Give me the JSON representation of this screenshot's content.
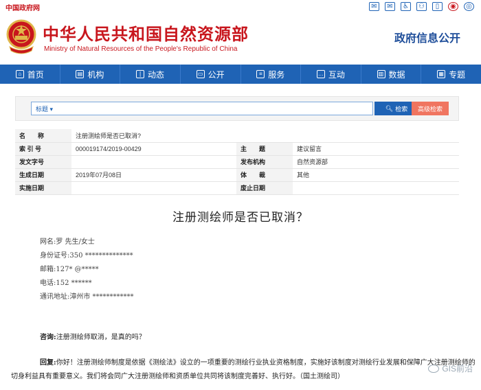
{
  "topbar": {
    "gov_link": "中国政府网",
    "icons": [
      "mail-icon",
      "message-icon",
      "accessibility-icon",
      "user-icon",
      "mobile-icon",
      "weibo-icon",
      "wechat-icon"
    ]
  },
  "header": {
    "title": "中华人民共和国自然资源部",
    "subtitle": "Ministry of Natural Resources of the People's Republic of China",
    "gov_info": "政府信息公开"
  },
  "nav": {
    "items": [
      {
        "label": "首页",
        "icon": "home-icon"
      },
      {
        "label": "机构",
        "icon": "org-icon"
      },
      {
        "label": "动态",
        "icon": "book-icon"
      },
      {
        "label": "公开",
        "icon": "monitor-icon"
      },
      {
        "label": "服务",
        "icon": "document-icon"
      },
      {
        "label": "互动",
        "icon": "chat-icon"
      },
      {
        "label": "数据",
        "icon": "chart-icon"
      },
      {
        "label": "专题",
        "icon": "topic-icon"
      }
    ]
  },
  "search": {
    "select_value": "标题",
    "search_label": "检索",
    "advanced_label": "高级检索"
  },
  "info": {
    "name_label": "名　　称",
    "name_value": "注册测绘师是否已取消?",
    "index_label": "索 引 号",
    "index_value": "000019174/2019-00429",
    "subject_label": "主　　题",
    "subject_value": "建议留言",
    "docno_label": "发文字号",
    "docno_value": "",
    "publisher_label": "发布机构",
    "publisher_value": "自然资源部",
    "date_label": "生成日期",
    "date_value": "2019年07月08日",
    "genre_label": "体　　裁",
    "genre_value": "其他",
    "impl_label": "实施日期",
    "impl_value": "",
    "expiry_label": "废止日期",
    "expiry_value": ""
  },
  "article": {
    "title": "注册测绘师是否已取消？",
    "fields": [
      "网名:罗 先生/女士",
      "身份证号:350 **************",
      "邮箱:127* @*****",
      "电话:152 ******",
      "通讯地址:漳州市 ************"
    ],
    "question_label": "咨询:",
    "question_text": "注册测绘师取消，是真的吗？",
    "answer_label": "回复:",
    "answer_text": "你好！注册测绘师制度是依据《测绘法》设立的一项重要的测绘行业执业资格制度，实施好该制度对测绘行业发展和保障广大注册测绘师的切身利益具有重要意义。我们将会同广大注册测绘师和资质单位共同将该制度完善好、执行好。（国土测绘司）"
  },
  "watermark": "GIS前沿"
}
